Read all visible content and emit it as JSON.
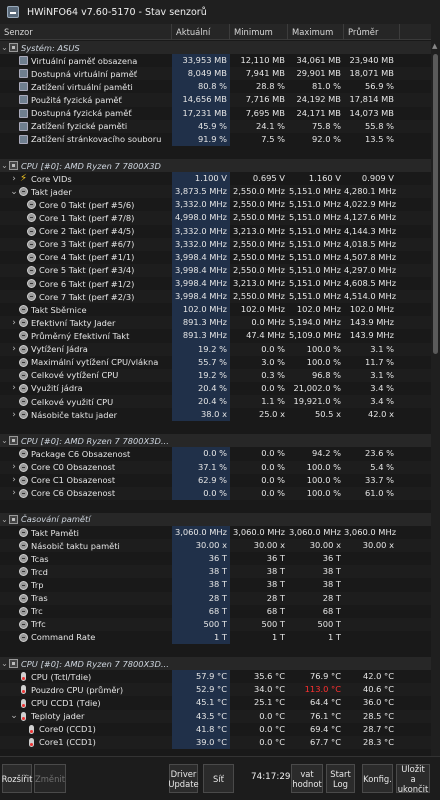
{
  "window": {
    "title": "HWiNFO64 v7.60-5170 - Stav senzorů"
  },
  "columns": {
    "name": "Senzor",
    "current": "Aktuální",
    "min": "Minimum",
    "max": "Maximum",
    "avg": "Průměr"
  },
  "rows": [
    {
      "kind": "group",
      "icon": "chip",
      "name": "Systém: ASUS"
    },
    {
      "kind": "sensor",
      "icon": "ram",
      "name": "Virtuální paměť obsazena",
      "cur": "33,953 MB",
      "min": "12,110 MB",
      "max": "34,061 MB",
      "avg": "23,940 MB"
    },
    {
      "kind": "sensor",
      "icon": "ram",
      "name": "Dostupná virtuální paměť",
      "cur": "8,049 MB",
      "min": "7,941 MB",
      "max": "29,901 MB",
      "avg": "18,071 MB"
    },
    {
      "kind": "sensor",
      "icon": "ram",
      "name": "Zatížení virtuální paměti",
      "cur": "80.8 %",
      "min": "28.8 %",
      "max": "81.0 %",
      "avg": "56.9 %"
    },
    {
      "kind": "sensor",
      "icon": "ram",
      "name": "Použitá fyzická paměť",
      "cur": "14,656 MB",
      "min": "7,716 MB",
      "max": "24,192 MB",
      "avg": "17,814 MB"
    },
    {
      "kind": "sensor",
      "icon": "ram",
      "name": "Dostupná fyzická paměť",
      "cur": "17,231 MB",
      "min": "7,695 MB",
      "max": "24,171 MB",
      "avg": "14,073 MB"
    },
    {
      "kind": "sensor",
      "icon": "ram",
      "name": "Zatížení fyzické paměti",
      "cur": "45.9 %",
      "min": "24.1 %",
      "max": "75.8 %",
      "avg": "55.8 %"
    },
    {
      "kind": "sensor",
      "icon": "ram",
      "name": "Zatížení stránkovacího souboru",
      "cur": "91.9 %",
      "min": "7.5 %",
      "max": "92.0 %",
      "avg": "13.5 %"
    },
    {
      "kind": "empty"
    },
    {
      "kind": "group",
      "icon": "chip",
      "name": "CPU [#0]: AMD Ryzen 7 7800X3D"
    },
    {
      "kind": "sensor",
      "icon": "bolt",
      "chev": "›",
      "name": "Core VIDs",
      "cur": "1.100 V",
      "min": "0.695 V",
      "max": "1.160 V",
      "avg": "0.909 V"
    },
    {
      "kind": "sensor",
      "icon": "circle",
      "chev": "⌄",
      "name": "Takt jader",
      "cur": "3,873.5 MHz",
      "min": "2,550.0 MHz",
      "max": "5,151.0 MHz",
      "avg": "4,280.1 MHz"
    },
    {
      "kind": "sensor",
      "icon": "circle",
      "indent": 1,
      "name": "Core 0 Takt (perf #5/6)",
      "cur": "3,332.0 MHz",
      "min": "2,550.0 MHz",
      "max": "5,151.0 MHz",
      "avg": "4,022.9 MHz"
    },
    {
      "kind": "sensor",
      "icon": "circle",
      "indent": 1,
      "name": "Core 1 Takt (perf #7/8)",
      "cur": "4,998.0 MHz",
      "min": "2,550.0 MHz",
      "max": "5,151.0 MHz",
      "avg": "4,127.6 MHz"
    },
    {
      "kind": "sensor",
      "icon": "circle",
      "indent": 1,
      "name": "Core 2 Takt (perf #4/5)",
      "cur": "3,332.0 MHz",
      "min": "3,213.0 MHz",
      "max": "5,151.0 MHz",
      "avg": "4,144.3 MHz"
    },
    {
      "kind": "sensor",
      "icon": "circle",
      "indent": 1,
      "name": "Core 3 Takt (perf #6/7)",
      "cur": "3,332.0 MHz",
      "min": "2,550.0 MHz",
      "max": "5,151.0 MHz",
      "avg": "4,018.5 MHz"
    },
    {
      "kind": "sensor",
      "icon": "circle",
      "indent": 1,
      "name": "Core 4 Takt (perf #1/1)",
      "cur": "3,998.4 MHz",
      "min": "2,550.0 MHz",
      "max": "5,151.0 MHz",
      "avg": "4,507.8 MHz"
    },
    {
      "kind": "sensor",
      "icon": "circle",
      "indent": 1,
      "name": "Core 5 Takt (perf #3/4)",
      "cur": "3,998.4 MHz",
      "min": "2,550.0 MHz",
      "max": "5,151.0 MHz",
      "avg": "4,297.0 MHz"
    },
    {
      "kind": "sensor",
      "icon": "circle",
      "indent": 1,
      "name": "Core 6 Takt (perf #1/2)",
      "cur": "3,998.4 MHz",
      "min": "3,213.0 MHz",
      "max": "5,151.0 MHz",
      "avg": "4,608.5 MHz"
    },
    {
      "kind": "sensor",
      "icon": "circle",
      "indent": 1,
      "name": "Core 7 Takt (perf #2/3)",
      "cur": "3,998.4 MHz",
      "min": "2,550.0 MHz",
      "max": "5,151.0 MHz",
      "avg": "4,514.0 MHz"
    },
    {
      "kind": "sensor",
      "icon": "circle",
      "name": "Takt Sběrnice",
      "cur": "102.0 MHz",
      "min": "102.0 MHz",
      "max": "102.0 MHz",
      "avg": "102.0 MHz"
    },
    {
      "kind": "sensor",
      "icon": "circle",
      "chev": "›",
      "name": "Efektivní Takty Jader",
      "cur": "891.3 MHz",
      "min": "0.0 MHz",
      "max": "5,194.0 MHz",
      "avg": "143.9 MHz"
    },
    {
      "kind": "sensor",
      "icon": "circle",
      "name": "Průměrný Efektivní Takt",
      "cur": "891.3 MHz",
      "min": "47.4 MHz",
      "max": "5,109.0 MHz",
      "avg": "143.9 MHz"
    },
    {
      "kind": "sensor",
      "icon": "circle",
      "chev": "›",
      "name": "Vytížení Jádra",
      "cur": "19.2 %",
      "min": "0.0 %",
      "max": "100.0 %",
      "avg": "3.1 %"
    },
    {
      "kind": "sensor",
      "icon": "circle",
      "name": "Maximální vytížení CPU/vlákna",
      "cur": "55.7 %",
      "min": "3.0 %",
      "max": "100.0 %",
      "avg": "11.7 %"
    },
    {
      "kind": "sensor",
      "icon": "circle",
      "name": "Celkové vytížení CPU",
      "cur": "19.2 %",
      "min": "0.3 %",
      "max": "96.8 %",
      "avg": "3.1 %"
    },
    {
      "kind": "sensor",
      "icon": "circle",
      "chev": "›",
      "name": "Využití jádra",
      "cur": "20.4 %",
      "min": "0.0 %",
      "max": "21,002.0 %",
      "avg": "3.4 %"
    },
    {
      "kind": "sensor",
      "icon": "circle",
      "name": "Celkové využití CPU",
      "cur": "20.4 %",
      "min": "1.1 %",
      "max": "19,921.0 %",
      "avg": "3.4 %"
    },
    {
      "kind": "sensor",
      "icon": "circle",
      "chev": "›",
      "name": "Násobiče taktu jader",
      "cur": "38.0 x",
      "min": "25.0 x",
      "max": "50.5 x",
      "avg": "42.0 x"
    },
    {
      "kind": "empty"
    },
    {
      "kind": "group",
      "icon": "chip",
      "name": "CPU [#0]: AMD Ryzen 7 7800X3D..."
    },
    {
      "kind": "sensor",
      "icon": "circle",
      "name": "Package C6 Obsazenost",
      "cur": "0.0 %",
      "min": "0.0 %",
      "max": "94.2 %",
      "avg": "23.6 %"
    },
    {
      "kind": "sensor",
      "icon": "circle",
      "chev": "›",
      "name": "Core C0 Obsazenost",
      "cur": "37.1 %",
      "min": "0.0 %",
      "max": "100.0 %",
      "avg": "5.4 %"
    },
    {
      "kind": "sensor",
      "icon": "circle",
      "chev": "›",
      "name": "Core C1 Obsazenost",
      "cur": "62.9 %",
      "min": "0.0 %",
      "max": "100.0 %",
      "avg": "33.7 %"
    },
    {
      "kind": "sensor",
      "icon": "circle",
      "chev": "›",
      "name": "Core C6 Obsazenost",
      "cur": "0.0 %",
      "min": "0.0 %",
      "max": "100.0 %",
      "avg": "61.0 %"
    },
    {
      "kind": "empty"
    },
    {
      "kind": "group",
      "icon": "chip",
      "name": "Časování pamětí"
    },
    {
      "kind": "sensor",
      "icon": "circle",
      "name": "Takt Paměti",
      "cur": "3,060.0 MHz",
      "min": "3,060.0 MHz",
      "max": "3,060.0 MHz",
      "avg": "3,060.0 MHz"
    },
    {
      "kind": "sensor",
      "icon": "circle",
      "name": "Násobič taktu paměti",
      "cur": "30.00 x",
      "min": "30.00 x",
      "max": "30.00 x",
      "avg": "30.00 x"
    },
    {
      "kind": "sensor",
      "icon": "circle",
      "name": "Tcas",
      "cur": "36 T",
      "min": "36 T",
      "max": "36 T",
      "avg": ""
    },
    {
      "kind": "sensor",
      "icon": "circle",
      "name": "Trcd",
      "cur": "38 T",
      "min": "38 T",
      "max": "38 T",
      "avg": ""
    },
    {
      "kind": "sensor",
      "icon": "circle",
      "name": "Trp",
      "cur": "38 T",
      "min": "38 T",
      "max": "38 T",
      "avg": ""
    },
    {
      "kind": "sensor",
      "icon": "circle",
      "name": "Tras",
      "cur": "28 T",
      "min": "28 T",
      "max": "28 T",
      "avg": ""
    },
    {
      "kind": "sensor",
      "icon": "circle",
      "name": "Trc",
      "cur": "68 T",
      "min": "68 T",
      "max": "68 T",
      "avg": ""
    },
    {
      "kind": "sensor",
      "icon": "circle",
      "name": "Trfc",
      "cur": "500 T",
      "min": "500 T",
      "max": "500 T",
      "avg": ""
    },
    {
      "kind": "sensor",
      "icon": "circle",
      "name": "Command Rate",
      "cur": "1 T",
      "min": "1 T",
      "max": "1 T",
      "avg": ""
    },
    {
      "kind": "empty"
    },
    {
      "kind": "group",
      "icon": "chip",
      "name": "CPU [#0]: AMD Ryzen 7 7800X3D..."
    },
    {
      "kind": "sensor",
      "icon": "therm",
      "name": "CPU (Tctl/Tdie)",
      "cur": "57.9 °C",
      "min": "35.6 °C",
      "max": "76.9 °C",
      "avg": "42.0 °C"
    },
    {
      "kind": "sensor",
      "icon": "therm",
      "name": "Pouzdro CPU (průměr)",
      "cur": "52.9 °C",
      "min": "34.0 °C",
      "max": "113.0 °C",
      "avg": "40.6 °C",
      "maxRed": true
    },
    {
      "kind": "sensor",
      "icon": "therm",
      "name": "CPU CCD1 (Tdie)",
      "cur": "45.1 °C",
      "min": "25.1 °C",
      "max": "64.4 °C",
      "avg": "36.0 °C"
    },
    {
      "kind": "sensor",
      "icon": "therm",
      "chev": "⌄",
      "name": "Teploty jader",
      "cur": "43.5 °C",
      "min": "0.0 °C",
      "max": "76.1 °C",
      "avg": "28.5 °C"
    },
    {
      "kind": "sensor",
      "icon": "therm",
      "indent": 1,
      "name": "Core0 (CCD1)",
      "cur": "41.8 °C",
      "min": "0.0 °C",
      "max": "69.4 °C",
      "avg": "28.7 °C"
    },
    {
      "kind": "sensor",
      "icon": "therm",
      "indent": 1,
      "name": "Core1 (CCD1)",
      "cur": "39.0 °C",
      "min": "0.0 °C",
      "max": "67.7 °C",
      "avg": "28.3 °C"
    }
  ],
  "toolbar": {
    "reset_label": "Rozšířit",
    "change_label": "Změnit",
    "driver_label": "Driver Update",
    "network_label": "Síť",
    "clock": "74:17:29",
    "reset_values_label": "vat hodnot",
    "start_log_label": "Start Log",
    "config_label": "Konfig.",
    "save_exit_label": "Uložit a ukončit"
  }
}
